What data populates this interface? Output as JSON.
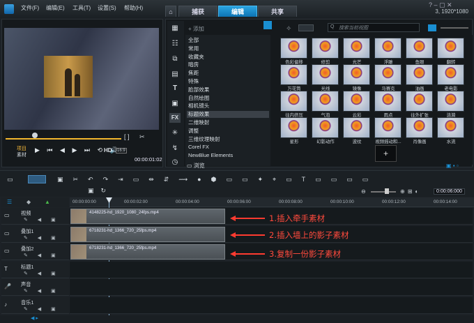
{
  "menu": [
    "文件(F)",
    "编辑(E)",
    "工具(T)",
    "设置(S)",
    "帮助(H)"
  ],
  "tabs": [
    "捕获",
    "编辑",
    "共享"
  ],
  "resolution": "3, 1920*1080",
  "library": {
    "add_label": "添加",
    "search_placeholder": "搜索当前视图",
    "categories": [
      "全部",
      "常用",
      "收藏夹",
      "暗房",
      "焦距",
      "特殊",
      "脸部效果",
      "自然绘图",
      "相机镜头",
      "标题效果",
      "二维映射",
      "调整",
      "三维纹理映射",
      "Corel FX",
      "NewBlue Elements"
    ],
    "selected_category": "标题效果",
    "browse_label": "浏览",
    "thumbs": [
      "色彩偏移",
      "修剪",
      "光芒",
      "浮雕",
      "鱼眼",
      "翻转",
      "万花筒",
      "光线",
      "镜像",
      "马赛克",
      "油画",
      "老电影",
      "往内挤压",
      "气泡",
      "云彩",
      "雨点",
      "往外扩张",
      "涟漪",
      "星形",
      "幻影动作",
      "波纹",
      "视频摇动和...",
      "肖像画",
      "水流"
    ]
  },
  "player": {
    "labels": [
      "项目",
      "素材"
    ],
    "timecode": "00:00:01:02",
    "hd_label": "HD",
    "ratio_label": "16:9"
  },
  "timeline": {
    "zoom_time": "0:00:06:000",
    "ticks": [
      "00:00:00:00",
      "00:00:02:00",
      "00:00:04:00",
      "00:00:06:00",
      "00:00:08:00",
      "00:00:10:00",
      "00:00:12:00",
      "00:00:14:00"
    ],
    "tracks": [
      {
        "name": "视频",
        "clip": "4148225-hd_1920_1080_24fps.mp4"
      },
      {
        "name": "叠加1",
        "clip": "6718231-hd_1366_720_25fps.mp4"
      },
      {
        "name": "叠加2",
        "clip": "6718231-hd_1366_720_25fps.mp4"
      },
      {
        "name": "标题1",
        "clip": ""
      },
      {
        "name": "声音",
        "clip": ""
      },
      {
        "name": "音乐1",
        "clip": ""
      }
    ]
  },
  "annotations": [
    "1.插入牵手素材",
    "2.插入墙上的影子素材",
    "3.复制一份影子素材"
  ],
  "colors": {
    "accent": "#1a8fd2",
    "annotation": "#ff3b30"
  }
}
